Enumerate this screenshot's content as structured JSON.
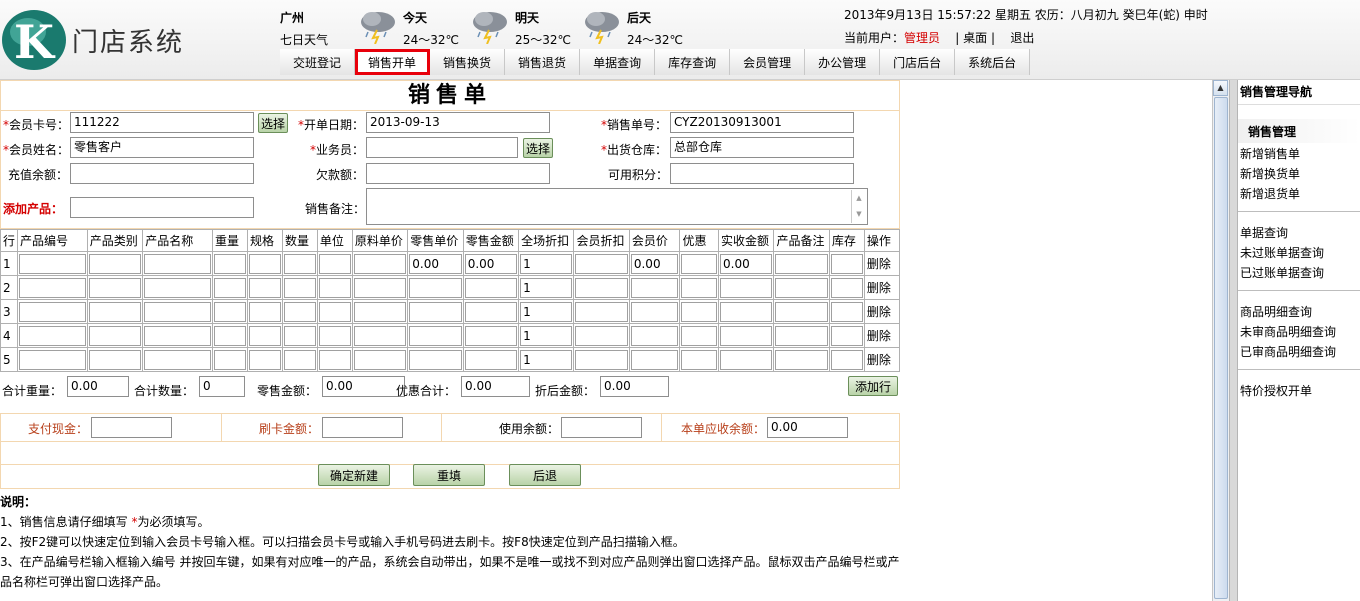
{
  "app": {
    "logo_text": "门店系统",
    "logo_letter": "K"
  },
  "weather": {
    "city": "广州",
    "label": "七日天气",
    "days": [
      {
        "name": "今天",
        "temp": "24～32℃"
      },
      {
        "name": "明天",
        "temp": "25～32℃"
      },
      {
        "name": "后天",
        "temp": "24～32℃"
      }
    ]
  },
  "header": {
    "datetime": "2013年9月13日  15:57:22 星期五  农历：八月初九  癸巳年(蛇) 申时",
    "user_label": "当前用户：",
    "user_name": "管理员",
    "desktop": "桌面",
    "logout": "退出",
    "sep": "|"
  },
  "nav": {
    "tabs": [
      "交班登记",
      "销售开单",
      "销售换货",
      "销售退货",
      "单据查询",
      "库存查询",
      "会员管理",
      "办公管理",
      "门店后台",
      "系统后台"
    ],
    "active": 1
  },
  "form": {
    "title": "销售单",
    "req_mark": "*",
    "member_card_label": "会员卡号：",
    "member_card": "111222",
    "select_btn": "选择",
    "open_date_label": "开单日期：",
    "open_date": "2013-09-13",
    "sale_no_label": "销售单号：",
    "sale_no": "CYZ20130913001",
    "member_name_label": "会员姓名：",
    "member_name": "零售客户",
    "salesman_label": "业务员：",
    "salesman": "",
    "warehouse_label": "出货仓库：",
    "warehouse": "总部仓库",
    "balance_label": "充值余额：",
    "balance": "",
    "debt_label": "欠款额：",
    "debt": "",
    "points_label": "可用积分：",
    "points": "",
    "add_product_label": "添加产品：",
    "add_product": "",
    "remark_label": "销售备注：",
    "remark": ""
  },
  "grid": {
    "columns": [
      "行",
      "产品编号",
      "产品类别",
      "产品名称",
      "重量",
      "规格",
      "数量",
      "单位",
      "原料单价",
      "零售单价",
      "零售金额",
      "全场折扣",
      "会员折扣",
      "会员价",
      "优惠",
      "实收金额",
      "产品备注",
      "库存",
      "操作"
    ],
    "rows": [
      {
        "no": "1",
        "retail_price": "0.00",
        "retail_amount": "0.00",
        "discount": "1",
        "member_price": "0.00",
        "actual": "0.00",
        "op": "删除"
      },
      {
        "no": "2",
        "retail_price": "",
        "retail_amount": "",
        "discount": "1",
        "member_price": "",
        "actual": "",
        "op": "删除"
      },
      {
        "no": "3",
        "retail_price": "",
        "retail_amount": "",
        "discount": "1",
        "member_price": "",
        "actual": "",
        "op": "删除"
      },
      {
        "no": "4",
        "retail_price": "",
        "retail_amount": "",
        "discount": "1",
        "member_price": "",
        "actual": "",
        "op": "删除"
      },
      {
        "no": "5",
        "retail_price": "",
        "retail_amount": "",
        "discount": "1",
        "member_price": "",
        "actual": "",
        "op": "删除"
      }
    ]
  },
  "totals": {
    "weight_label": "合计重量：",
    "weight": "0.00",
    "qty_label": "合计数量：",
    "qty": "0",
    "retail_label": "零售金额：",
    "retail": "0.00",
    "discount_label": "优惠合计：",
    "discount": "0.00",
    "after_label": "折后金额：",
    "after": "0.00",
    "add_row_btn": "添加行"
  },
  "payment": {
    "cash_label": "支付现金：",
    "cash": "",
    "card_label": "刷卡金额：",
    "card": "",
    "use_balance_label": "使用余额：",
    "use_balance": "",
    "due_label": "本单应收余额：",
    "due": "0.00"
  },
  "actions": {
    "confirm": "确定新建",
    "reset": "重填",
    "back": "后退"
  },
  "notes": {
    "title": "说明：",
    "line1_pre": "1、销售信息请仔细填写 ",
    "line1_req": "*",
    "line1_post": "为必须填写。",
    "line2": "2、按F2键可以快速定位到输入会员卡号输入框。可以扫描会员卡号或输入手机号码进去刷卡。按F8快速定位到产品扫描输入框。",
    "line3": "3、在产品编号栏输入框输入编号 并按回车键，如果有对应唯一的产品，系统会自动带出，如果不是唯一或找不到对应产品则弹出窗口选择产品。鼠标双击产品编号栏或产品名称栏可弹出窗口选择产品。"
  },
  "rightnav": {
    "title": "销售管理导航",
    "section": "销售管理",
    "group1": [
      "新增销售单",
      "新增换货单",
      "新增退货单"
    ],
    "group2": [
      "单据查询",
      "未过账单据查询",
      "已过账单据查询"
    ],
    "group3": [
      "商品明细查询",
      "未审商品明细查询",
      "已审商品明细查询"
    ],
    "group4": [
      "特价授权开单"
    ]
  },
  "colors": {
    "required": "#d40000",
    "active_tab_border": "#e8000b",
    "logo": "#1a7a6e",
    "frame": "#f3d7b0",
    "pay_label": "#b8401b"
  },
  "icons": {
    "weather": "thunderstorm-icon",
    "scroll_up": "scroll-up-arrow-icon"
  }
}
